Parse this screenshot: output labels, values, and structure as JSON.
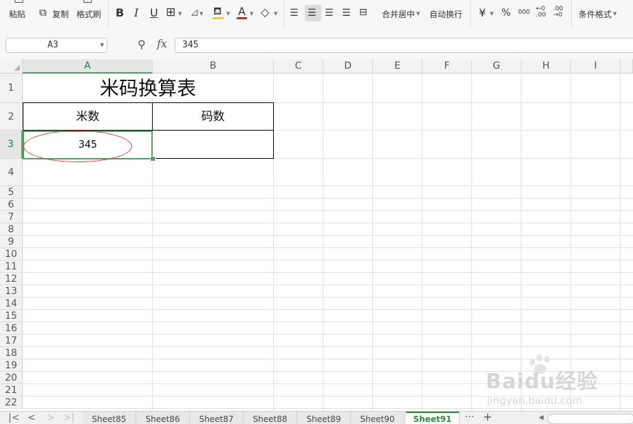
{
  "toolbar": {
    "paste_label": "粘贴",
    "copy_label": "复制",
    "format_painter_label": "格式刷",
    "bold": "B",
    "italic": "I",
    "underline": "U",
    "font_color_glyph": "A",
    "merge_center_label": "合并居中",
    "wrap_text_label": "自动换行",
    "currency_glyph": "¥",
    "percent_glyph": "%",
    "thousands_glyph": "000",
    "conditional_format_label": "条件格式",
    "accent_color": "#217346",
    "font_color_bar": "#e02020",
    "fill_color_bar": "#f5d000",
    "icons": [
      "paste-icon",
      "copy-icon",
      "format-painter-icon",
      "bold-icon",
      "italic-icon",
      "underline-icon",
      "border-icon",
      "fill-color-icon",
      "font-color-icon",
      "clear-icon",
      "align-left-icon",
      "align-center-icon",
      "align-right-icon",
      "justify-icon",
      "distributed-icon",
      "currency-icon",
      "percent-icon",
      "thousands-icon",
      "increase-decimal-icon",
      "decrease-decimal-icon"
    ]
  },
  "formula_bar": {
    "name_box": "A3",
    "fx_label": "fx",
    "formula_value": "345"
  },
  "grid": {
    "columns": [
      "A",
      "B",
      "C",
      "D",
      "E",
      "F",
      "G",
      "H",
      "I"
    ],
    "rows": [
      "1",
      "2",
      "3",
      "4",
      "5",
      "6",
      "7",
      "8",
      "9",
      "10",
      "11",
      "12",
      "13",
      "14",
      "15",
      "16",
      "17",
      "18",
      "19",
      "20",
      "21",
      "22"
    ],
    "selected_column": "A",
    "selected_row": "3",
    "cells": {
      "title": "米码换算表",
      "header_a": "米数",
      "header_b": "码数",
      "a3": "345",
      "b3": ""
    },
    "highlight_color": "#d23b3b"
  },
  "sheet_tabs": {
    "tabs": [
      "Sheet85",
      "Sheet86",
      "Sheet87",
      "Sheet88",
      "Sheet89",
      "Sheet90",
      "Sheet91"
    ],
    "active": "Sheet91",
    "more_label": "···",
    "add_label": "+"
  },
  "watermark": {
    "brand": "Baidu经验",
    "url": "jingyan.baidu.com"
  }
}
